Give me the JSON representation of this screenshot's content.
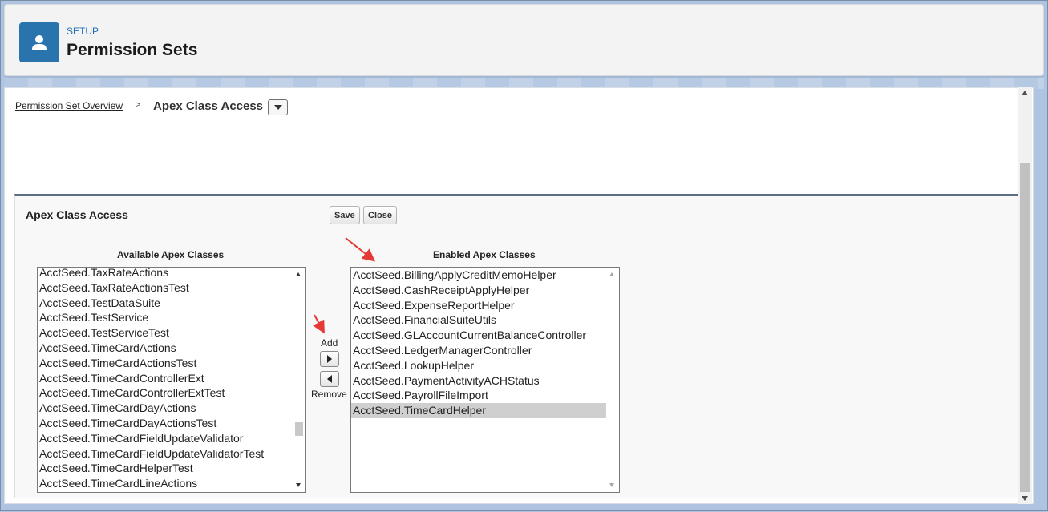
{
  "header": {
    "eyebrow": "SETUP",
    "title": "Permission Sets",
    "icon": "user-icon",
    "icon_bg": "#2a74ad"
  },
  "breadcrumb": {
    "link": "Permission Set Overview",
    "separator": ">",
    "current": "Apex Class Access",
    "menu_icon": "chevron-down-icon"
  },
  "block": {
    "title": "Apex Class Access",
    "save_label": "Save",
    "close_label": "Close"
  },
  "available": {
    "label": "Available Apex Classes",
    "items": [
      "AcctSeed.TaxRateActions",
      "AcctSeed.TaxRateActionsTest",
      "AcctSeed.TestDataSuite",
      "AcctSeed.TestService",
      "AcctSeed.TestServiceTest",
      "AcctSeed.TimeCardActions",
      "AcctSeed.TimeCardActionsTest",
      "AcctSeed.TimeCardControllerExt",
      "AcctSeed.TimeCardControllerExtTest",
      "AcctSeed.TimeCardDayActions",
      "AcctSeed.TimeCardDayActionsTest",
      "AcctSeed.TimeCardFieldUpdateValidator",
      "AcctSeed.TimeCardFieldUpdateValidatorTest",
      "AcctSeed.TimeCardHelperTest",
      "AcctSeed.TimeCardLineActions"
    ]
  },
  "mover": {
    "add_label": "Add",
    "remove_label": "Remove"
  },
  "enabled": {
    "label": "Enabled Apex Classes",
    "items": [
      "AcctSeed.BillingApplyCreditMemoHelper",
      "AcctSeed.CashReceiptApplyHelper",
      "AcctSeed.ExpenseReportHelper",
      "AcctSeed.FinancialSuiteUtils",
      "AcctSeed.GLAccountCurrentBalanceController",
      "AcctSeed.LedgerManagerController",
      "AcctSeed.LookupHelper",
      "AcctSeed.PaymentActivityACHStatus",
      "AcctSeed.PayrollFileImport",
      "AcctSeed.TimeCardHelper"
    ],
    "selected_index": 9
  },
  "colors": {
    "annotation_arrow": "#e53935",
    "block_border": "#5c6d84"
  }
}
